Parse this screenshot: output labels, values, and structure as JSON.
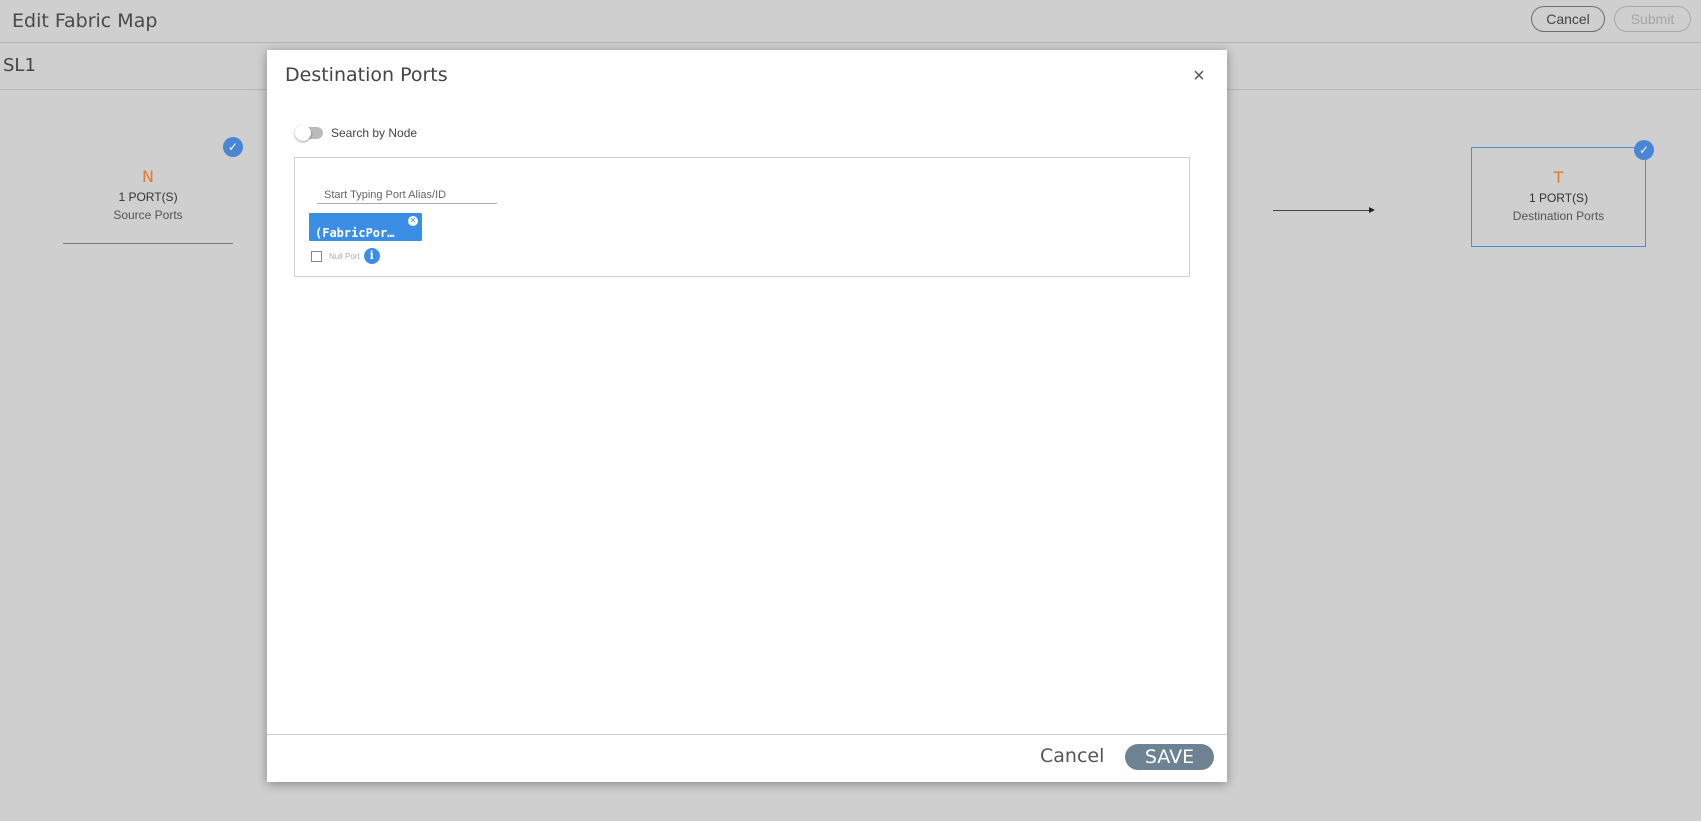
{
  "header": {
    "title": "Edit Fabric Map",
    "cancel_label": "Cancel",
    "submit_label": "Submit"
  },
  "subheader": {
    "title": "SL1"
  },
  "source_node": {
    "letter": "N",
    "count": "1 PORT(S)",
    "label": "Source Ports",
    "check_icon": "check-circle-icon"
  },
  "destination_node": {
    "letter": "T",
    "count": "1 PORT(S)",
    "label": "Destination Ports",
    "check_icon": "check-circle-icon"
  },
  "modal": {
    "title": "Destination Ports",
    "close_icon": "close-icon",
    "search_by_node_label": "Search by Node",
    "search_by_node_enabled": false,
    "port_input_placeholder": "Start Typing Port Alias/ID",
    "selected_port_chip": "(FabricPor…",
    "null_port_label": "Null Port",
    "null_port_checked": false,
    "cancel_label": "Cancel",
    "save_label": "SAVE"
  },
  "colors": {
    "accent_blue": "#3b8ee6",
    "node_letter_orange": "#e07a2e",
    "save_button": "#6d8394",
    "overlay_gray": "#cfcfcf"
  }
}
